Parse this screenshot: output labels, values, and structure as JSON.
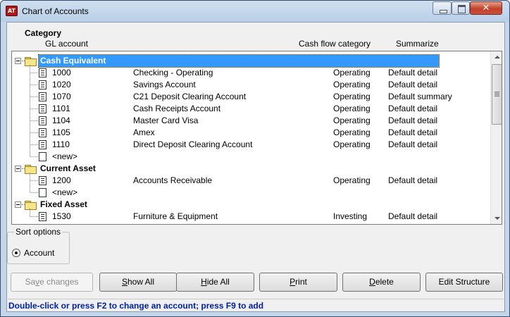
{
  "window": {
    "icon_text": "AT",
    "title": "Chart of Accounts",
    "close_glyph": "✕"
  },
  "columns": {
    "category": "Category",
    "gl_account": "GL account",
    "cash_flow": "Cash flow category",
    "summarize": "Summarize"
  },
  "tree": {
    "categories": [
      {
        "name": "Cash Equivalent",
        "selected": true,
        "accounts": [
          {
            "number": "1000",
            "description": "Checking - Operating",
            "cash_flow": "Operating",
            "summarize": "Default detail"
          },
          {
            "number": "1020",
            "description": "Savings Account",
            "cash_flow": "Operating",
            "summarize": "Default detail"
          },
          {
            "number": "1070",
            "description": "C21 Deposit Clearing Account",
            "cash_flow": "Operating",
            "summarize": "Default summary"
          },
          {
            "number": "1101",
            "description": "Cash Receipts Account",
            "cash_flow": "Operating",
            "summarize": "Default detail"
          },
          {
            "number": "1104",
            "description": "Master Card Visa",
            "cash_flow": "Operating",
            "summarize": "Default detail"
          },
          {
            "number": "1105",
            "description": "Amex",
            "cash_flow": "Operating",
            "summarize": "Default detail"
          },
          {
            "number": "1110",
            "description": "Direct Deposit Clearing Account",
            "cash_flow": "Operating",
            "summarize": "Default detail"
          }
        ],
        "new_label": "<new>"
      },
      {
        "name": "Current Asset",
        "selected": false,
        "accounts": [
          {
            "number": "1200",
            "description": "Accounts Receivable",
            "cash_flow": "Operating",
            "summarize": "Default detail"
          }
        ],
        "new_label": "<new>"
      },
      {
        "name": "Fixed Asset",
        "selected": false,
        "accounts": [
          {
            "number": "1530",
            "description": "Furniture & Equipment",
            "cash_flow": "Investing",
            "summarize": "Default detail"
          }
        ]
      }
    ]
  },
  "sort_options": {
    "legend": "Sort options",
    "selected": "Account"
  },
  "buttons": {
    "save": {
      "pre": "Sa",
      "key": "v",
      "post": "e changes"
    },
    "show_all": {
      "pre": "",
      "key": "S",
      "post": "how All"
    },
    "hide_all": {
      "pre": "",
      "key": "H",
      "post": "ide All"
    },
    "print": {
      "pre": "",
      "key": "P",
      "post": "rint"
    },
    "delete": {
      "pre": "",
      "key": "D",
      "post": "elete"
    },
    "edit_structure": {
      "pre": "",
      "key": "",
      "post": "Edit Structure"
    }
  },
  "status_text": "Double-click or press F2 to change an account; press F9 to add"
}
